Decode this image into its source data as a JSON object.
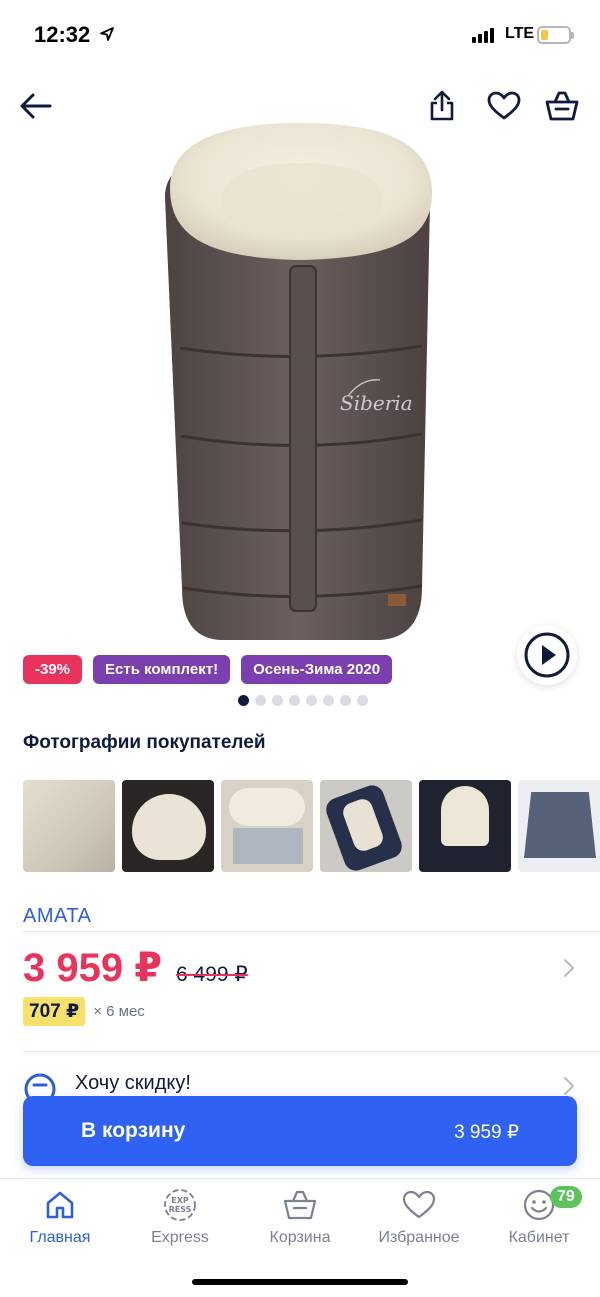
{
  "status_bar": {
    "time": "12:32",
    "network": "LTE",
    "battery_level": 0.25
  },
  "top_nav": {
    "back_icon": "arrow-left-icon",
    "share_icon": "share-icon",
    "favorite_icon": "heart-icon",
    "cart_icon": "basket-icon"
  },
  "product": {
    "image_alt": "sleeping-bag-image",
    "image_brand_mark": "Siberia",
    "badges": [
      {
        "label": "-39%",
        "color": "#e8345d"
      },
      {
        "label": "Есть комплект!",
        "color": "#7b3fb0"
      },
      {
        "label": "Осень-Зима 2020",
        "color": "#7b3fb0"
      }
    ],
    "gallery_dots": 8,
    "gallery_active": 0
  },
  "customer_photos": {
    "title": "Фотографии покупателей",
    "count": 6
  },
  "brand": "AMATA",
  "price": {
    "current": "3 959 ₽",
    "old": "6 499 ₽",
    "installment_amount": "707 ₽",
    "installment_term": "× 6 мес"
  },
  "discount_row": {
    "label": "Хочу скидку!"
  },
  "cta": {
    "label": "В корзину",
    "price": "3 959 ₽"
  },
  "tabbar": {
    "items": [
      {
        "label": "Главная",
        "icon": "home-icon",
        "active": true
      },
      {
        "label": "Express",
        "icon": "express-icon",
        "active": false
      },
      {
        "label": "Корзина",
        "icon": "basket-icon",
        "active": false
      },
      {
        "label": "Избранное",
        "icon": "heart-icon",
        "active": false
      },
      {
        "label": "Кабинет",
        "icon": "smiley-icon",
        "active": false,
        "badge": "79"
      }
    ],
    "express_icon_text_top": "EXP",
    "express_icon_text_bottom": "RESS"
  },
  "colors": {
    "accent": "#2f62f2",
    "price": "#e8345d",
    "badge_purple": "#7b3fb0",
    "highlight": "#f7e16b"
  }
}
